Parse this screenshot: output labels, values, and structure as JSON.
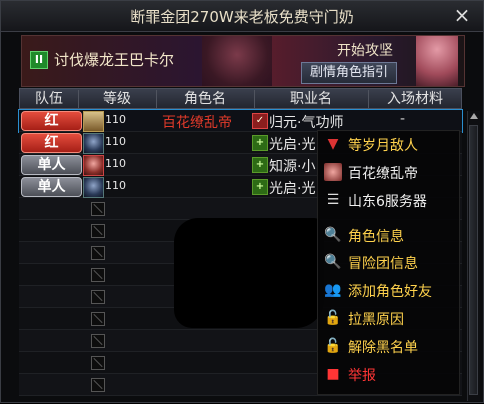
{
  "window": {
    "title": "断罪金团270W来老板免费守门奶",
    "close_glyph": "×"
  },
  "banner": {
    "quest_badge": "II",
    "quest_title": "讨伐爆龙王巴卡尔",
    "guide_title": "开始攻坚",
    "guide_button": "剧情角色指引"
  },
  "table": {
    "headers": [
      "队伍",
      "等级",
      "角色名",
      "职业名",
      "入场材料"
    ],
    "rows": [
      {
        "team": "红",
        "team_style": "red",
        "level": "110",
        "name": "百花缭乱帝",
        "job": "归元·气功师",
        "material": "-",
        "selected": true
      },
      {
        "team": "红",
        "team_style": "red",
        "level": "110",
        "name": "",
        "job": "光启·光"
      },
      {
        "team": "单人",
        "team_style": "gray",
        "level": "110",
        "name": "",
        "job": "知源·小"
      },
      {
        "team": "单人",
        "team_style": "gray",
        "level": "110",
        "name": "",
        "job": "光启·光"
      }
    ]
  },
  "context_menu": {
    "header_items": [
      {
        "label": "等岁月敌人",
        "icon": "shield-icon"
      },
      {
        "label": "百花缭乱帝",
        "icon": "avatar-icon"
      },
      {
        "label": "山东6服务器",
        "icon": "server-icon"
      }
    ],
    "items": [
      {
        "label": "角色信息",
        "icon": "magnifier-icon",
        "glyph": "🔍"
      },
      {
        "label": "冒险团信息",
        "icon": "magnifier-icon",
        "glyph": "🔍"
      },
      {
        "label": "添加角色好友",
        "icon": "add-friend-icon",
        "glyph": "👥"
      },
      {
        "label": "拉黑原因",
        "icon": "unlock-icon",
        "glyph": "🔓"
      },
      {
        "label": "解除黑名单",
        "icon": "unlock-icon",
        "glyph": "🔓"
      },
      {
        "label": "举报",
        "icon": "report-icon",
        "glyph": "■"
      }
    ]
  }
}
